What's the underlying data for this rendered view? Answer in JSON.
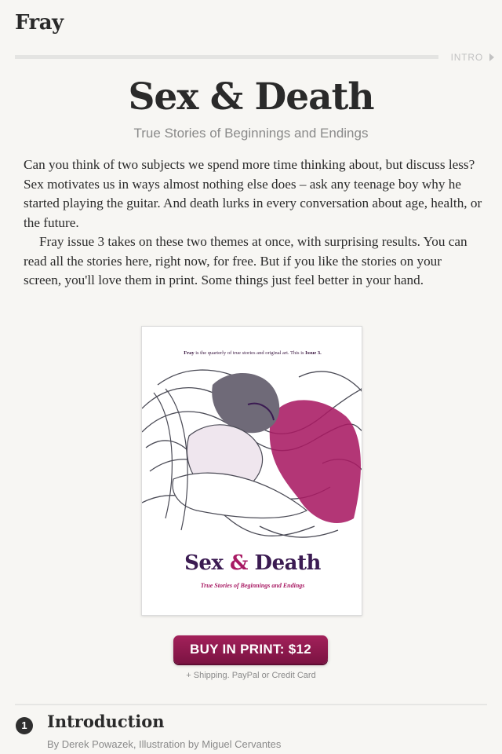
{
  "app": {
    "brand": "Fray"
  },
  "section": {
    "label": "INTRO"
  },
  "article": {
    "title": "Sex & Death",
    "subtitle": "True Stories of Beginnings and Endings",
    "paragraphs": [
      "Can you think of two subjects we spend more time thinking about, but discuss less? Sex motivates us in ways almost nothing else does – ask any teenage boy why he started playing the guitar. And death lurks in every conversation about age, health, or the future.",
      "Fray issue 3 takes on these two themes at once, with surprising results. You can read all the stories here, right now, for free. But if you like the stories on your screen, you'll love them in print. Some things just feel better in your hand."
    ]
  },
  "cover": {
    "tagline_brand": "Fray",
    "tagline_text": " is the quarterly of true stories and original art. This is ",
    "tagline_issue": "Issue 3.",
    "title_left": "Sex ",
    "title_amp": "&",
    "title_right": " Death",
    "subtitle": "True Stories of Beginnings and Endings",
    "colors": {
      "purple": "#3b1b52",
      "magenta": "#a81a63"
    }
  },
  "purchase": {
    "button_label": "BUY IN PRINT: $12",
    "note": "+ Shipping. PayPal or Credit Card",
    "button_color": "#8e1a4e"
  },
  "chapter": {
    "number": "1",
    "title": "Introduction",
    "byline": "By Derek Powazek, Illustration by Miguel Cervantes"
  },
  "icons": {
    "section_arrow": "triangle-right-icon"
  }
}
